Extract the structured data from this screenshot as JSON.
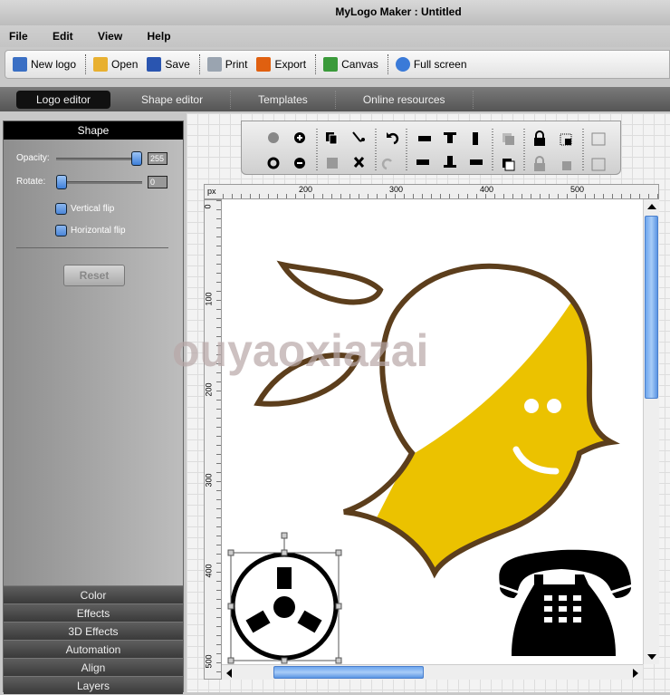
{
  "window": {
    "title": "MyLogo Maker : Untitled"
  },
  "menu": [
    "File",
    "Edit",
    "View",
    "Help"
  ],
  "toolbar": [
    {
      "label": "New logo",
      "icon": "new-logo-icon",
      "color": "#3a6fc4"
    },
    {
      "label": "Open",
      "icon": "folder-open-icon",
      "color": "#e8b030"
    },
    {
      "label": "Save",
      "icon": "floppy-disk-icon",
      "color": "#2a55b0"
    },
    {
      "label": "Print",
      "icon": "printer-icon",
      "color": "#9aa4b0"
    },
    {
      "label": "Export",
      "icon": "export-icon",
      "color": "#e06010"
    },
    {
      "label": "Canvas",
      "icon": "canvas-icon",
      "color": "#3a9a3a"
    },
    {
      "label": "Full screen",
      "icon": "full-screen-icon",
      "color": "#3a7ad8"
    }
  ],
  "tabs": [
    {
      "label": "Logo editor",
      "active": true
    },
    {
      "label": "Shape editor"
    },
    {
      "label": "Templates"
    },
    {
      "label": "Online resources"
    }
  ],
  "shape_panel": {
    "title": "Shape",
    "opacity_label": "Opacity:",
    "opacity_value": "255",
    "opacity_max": "255",
    "rotate_label": "Rotate:",
    "rotate_value": "0",
    "vertical_flip": "Vertical flip",
    "horizontal_flip": "Horizontal flip",
    "reset": "Reset"
  },
  "accordion": [
    "Color",
    "Effects",
    "3D Effects",
    "Automation",
    "Align",
    "Layers"
  ],
  "ruler": {
    "unit": "px",
    "h_ticks": [
      "200",
      "300",
      "400",
      "500"
    ],
    "v_ticks": [
      "0",
      "100",
      "200",
      "300",
      "400",
      "500"
    ]
  },
  "logo_colors": {
    "outline": "#5c3e1c",
    "fill": "#ebc200"
  },
  "watermark": "ouyaoxiazai",
  "scroll": {
    "vertical_fraction": 0.0,
    "horizontal_fraction": 0.12
  }
}
